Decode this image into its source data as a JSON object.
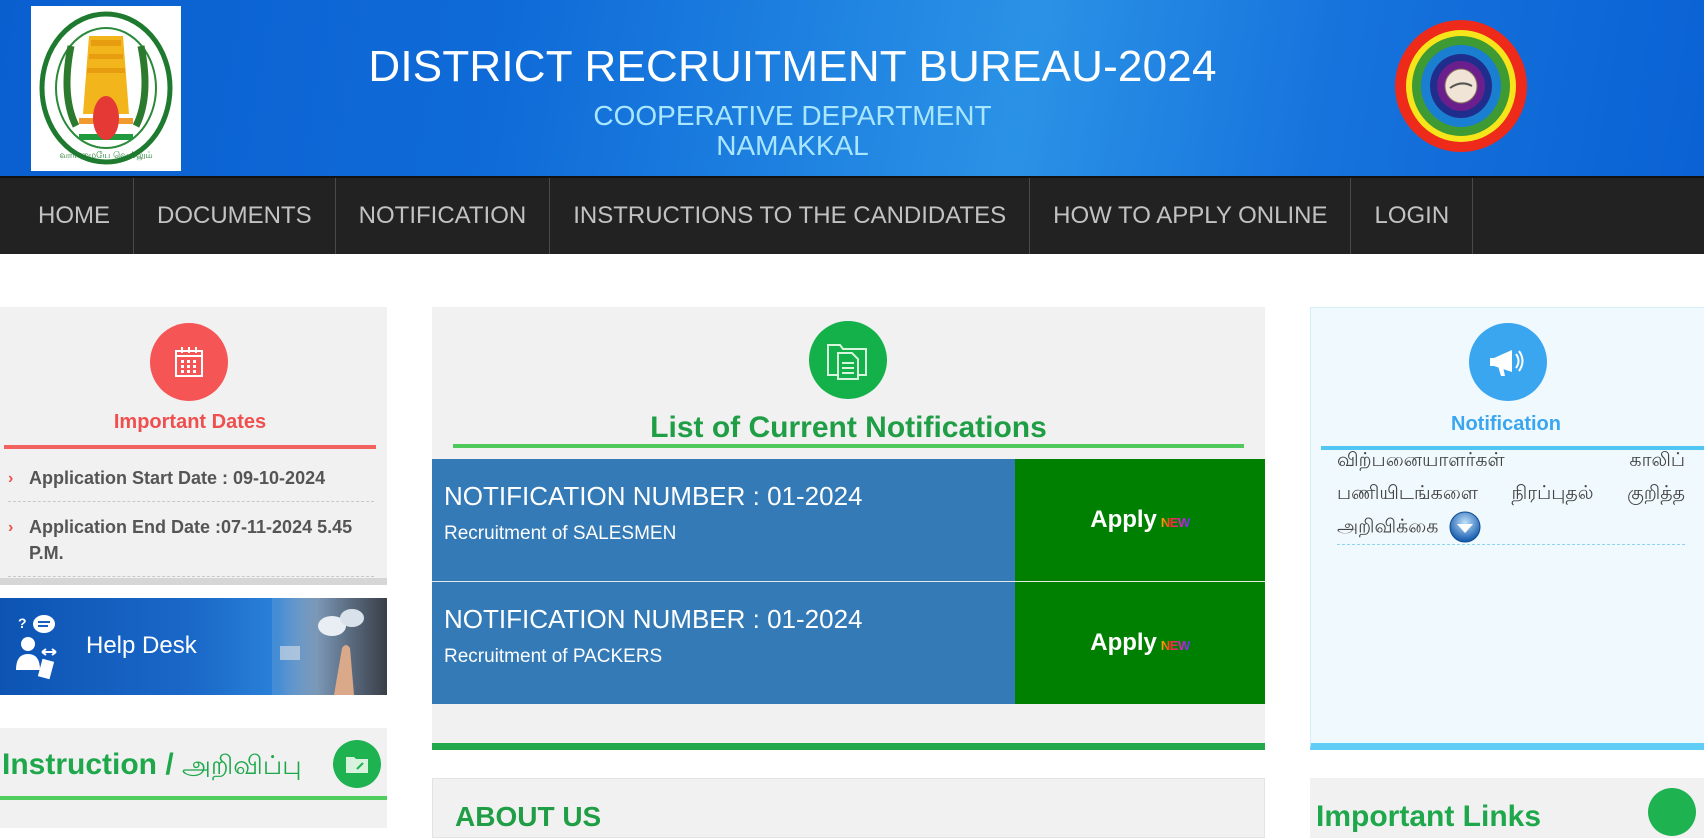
{
  "header": {
    "title": "DISTRICT RECRUITMENT BUREAU-2024",
    "subtitle_line1": "COOPERATIVE DEPARTMENT",
    "subtitle_line2": "NAMAKKAL",
    "left_logo": "tamil-nadu-emblem",
    "right_logo": "cooperative-rainbow-logo"
  },
  "nav": {
    "items": [
      {
        "label": "HOME"
      },
      {
        "label": "DOCUMENTS"
      },
      {
        "label": "NOTIFICATION"
      },
      {
        "label": "INSTRUCTIONS TO THE CANDIDATES"
      },
      {
        "label": "HOW TO APPLY ONLINE"
      },
      {
        "label": "LOGIN"
      }
    ]
  },
  "important_dates": {
    "icon": "calendar-icon",
    "heading": "Important Dates",
    "accent_color": "#ef4f4f",
    "items": [
      {
        "text": "Application Start Date : 09-10-2024"
      },
      {
        "text": "Application End Date :07-11-2024 5.45 P.M."
      }
    ]
  },
  "help_desk": {
    "label": "Help Desk",
    "icon": "help-desk-icon"
  },
  "instruction": {
    "heading_en": "Instruction /",
    "heading_ta": "அறிவிப்பு",
    "icon": "folder-edit-icon"
  },
  "notifications": {
    "icon": "folder-document-icon",
    "heading": "List of Current Notifications",
    "rows": [
      {
        "number": "NOTIFICATION NUMBER : 01-2024",
        "description": "Recruitment of SALESMEN",
        "apply_label": "Apply",
        "badge": "NEW"
      },
      {
        "number": "NOTIFICATION NUMBER : 01-2024",
        "description": "Recruitment of PACKERS",
        "apply_label": "Apply",
        "badge": "NEW"
      }
    ],
    "row_color": "#337ab7",
    "apply_color": "#008000"
  },
  "about": {
    "heading": "ABOUT US"
  },
  "right_notification": {
    "icon": "megaphone-icon",
    "heading": "Notification",
    "notice_text": "விற்பனையாளர்கள் காலிப் பணியிடங்களை நிரப்புதல் குறித்த அறிவிக்கை",
    "download_icon": "download-icon"
  },
  "important_links": {
    "heading": "Important Links"
  }
}
